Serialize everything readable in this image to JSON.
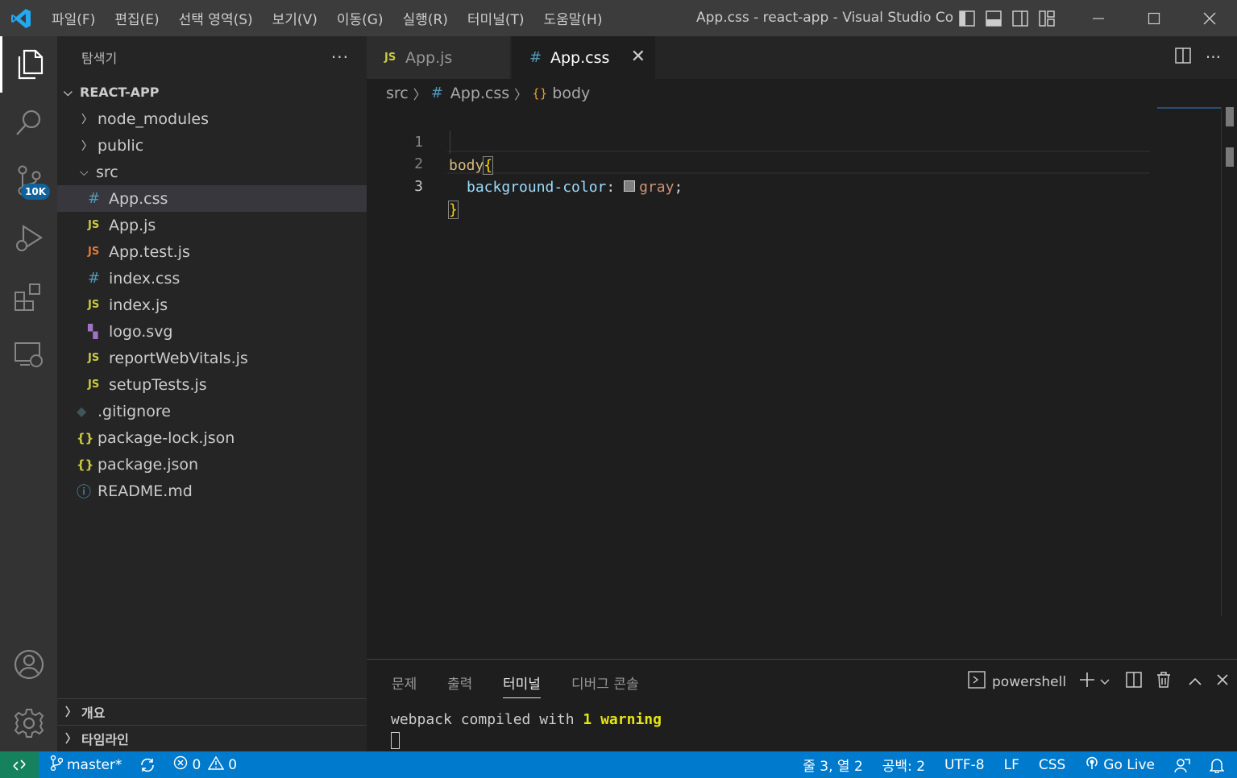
{
  "titlebar": {
    "menu": [
      "파일(F)",
      "편집(E)",
      "선택 영역(S)",
      "보기(V)",
      "이동(G)",
      "실행(R)",
      "터미널(T)",
      "도움말(H)"
    ],
    "title": "App.css - react-app - Visual Studio Co..."
  },
  "activity": {
    "scm_badge": "10K"
  },
  "sidebar": {
    "header": "탐색기",
    "more": "···",
    "root": "REACT-APP",
    "items": [
      {
        "label": "node_modules",
        "icon": "folder-closed"
      },
      {
        "label": "public",
        "icon": "folder-closed"
      },
      {
        "label": "src",
        "icon": "folder-open"
      },
      {
        "label": "App.css",
        "icon": "#"
      },
      {
        "label": "App.js",
        "icon": "JS"
      },
      {
        "label": "App.test.js",
        "icon": "JS"
      },
      {
        "label": "index.css",
        "icon": "#"
      },
      {
        "label": "index.js",
        "icon": "JS"
      },
      {
        "label": "logo.svg",
        "icon": "svg"
      },
      {
        "label": "reportWebVitals.js",
        "icon": "JS"
      },
      {
        "label": "setupTests.js",
        "icon": "JS"
      },
      {
        "label": ".gitignore",
        "icon": "git"
      },
      {
        "label": "package-lock.json",
        "icon": "{}"
      },
      {
        "label": "package.json",
        "icon": "{}"
      },
      {
        "label": "README.md",
        "icon": "info"
      }
    ],
    "icon_js": "JS",
    "icon_css": "#",
    "icon_json": "{}",
    "icon_info": "ⓘ",
    "icon_git": "◆",
    "icon_svg": "▚",
    "sections": [
      "개요",
      "타임라인"
    ]
  },
  "tabs": [
    {
      "label": "App.js",
      "icon": "JS"
    },
    {
      "label": "App.css",
      "icon": "#",
      "close": "✕"
    }
  ],
  "breadcrumb": {
    "folder": "src",
    "file": "App.css",
    "file_icon": "#",
    "symbol": "body",
    "symbol_icon": "{}"
  },
  "editor": {
    "lines": [
      {
        "num": "1",
        "selector": "body",
        "brace": "{"
      },
      {
        "num": "2",
        "property": "background-color",
        "colon": ":",
        "value": "gray",
        "semi": ";"
      },
      {
        "num": "3",
        "brace": "}"
      }
    ],
    "colors": {
      "selector": "#d7ba7d",
      "property": "#9cdcfe",
      "value": "#ce9178",
      "brace": "#ffd700"
    }
  },
  "panel": {
    "tabs": [
      "문제",
      "출력",
      "터미널",
      "디버그 콘솔"
    ],
    "active_tab": "터미널",
    "shell": "powershell",
    "terminal": {
      "prefix": "webpack compiled with ",
      "warning": "1 warning"
    }
  },
  "statusbar": {
    "branch": "master*",
    "errors": "0",
    "warnings": "0",
    "position": "줄 3, 열 2",
    "spaces": "공백: 2",
    "encoding": "UTF-8",
    "eol": "LF",
    "language": "CSS",
    "golive": "Go Live"
  }
}
